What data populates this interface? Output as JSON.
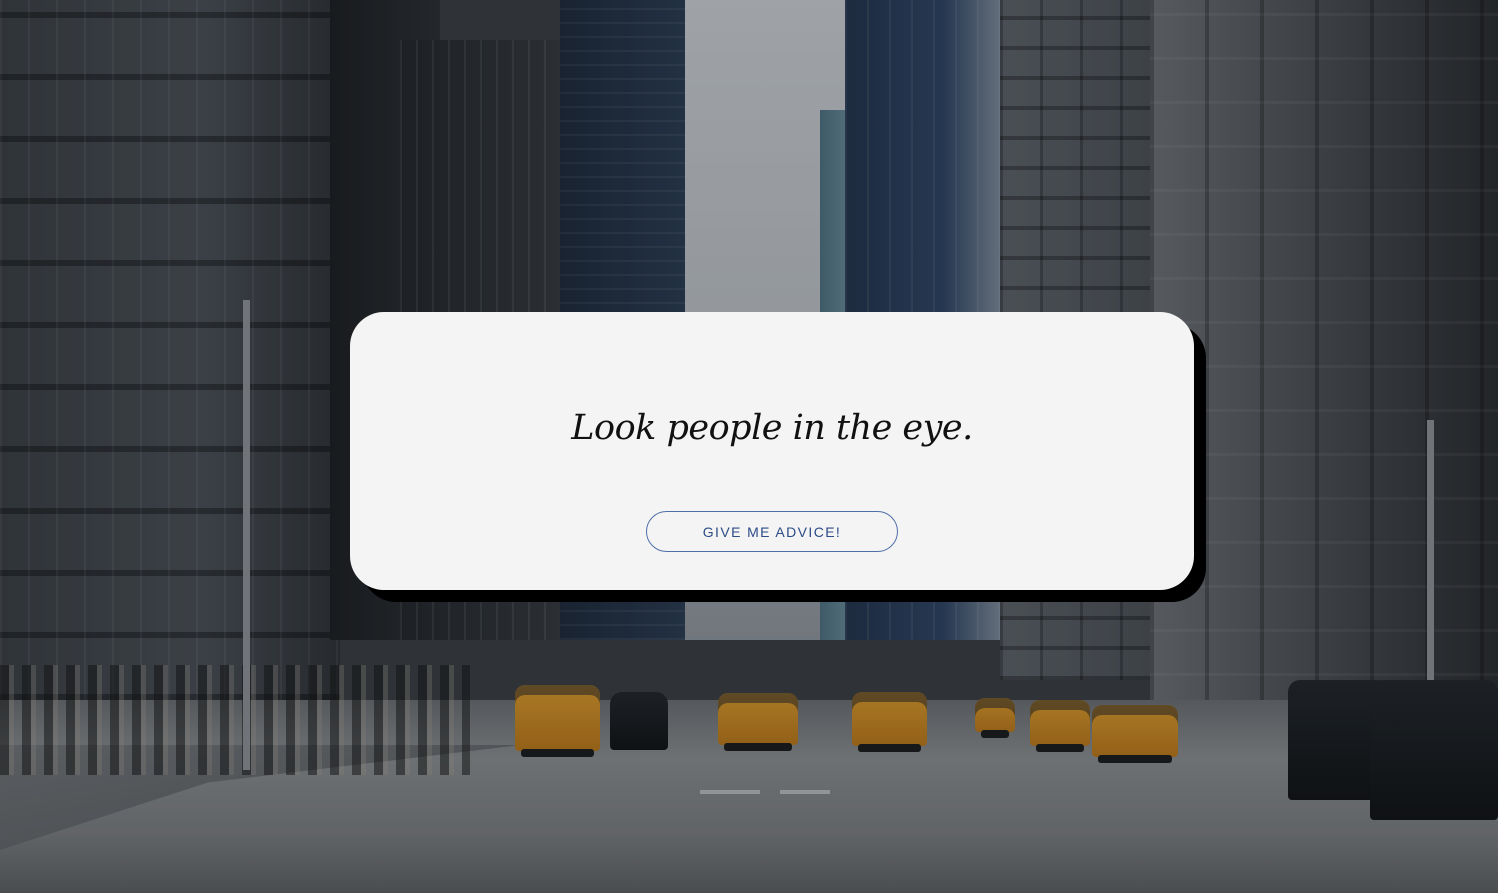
{
  "background": {
    "scene": "city street with buildings and taxis"
  },
  "card": {
    "advice_text": "Look people in the eye.",
    "button_label": "GIVE ME ADVICE!"
  },
  "colors": {
    "card_bg": "#f4f4f4",
    "card_shadow": "#000000",
    "button_border": "#4f6fa9",
    "button_text": "#2c4b87"
  }
}
